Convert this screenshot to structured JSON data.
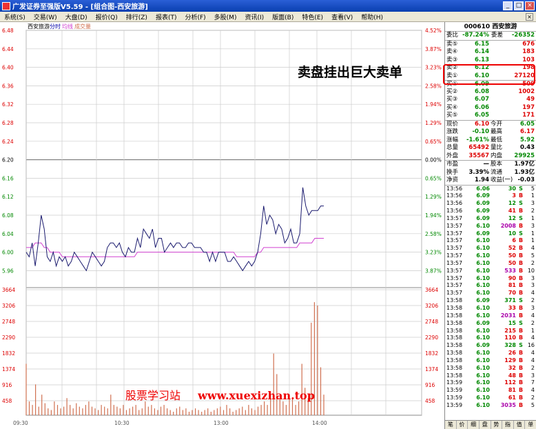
{
  "window": {
    "title": "广发证券至强版V5.59 - [组合图-西安旅游]"
  },
  "window_buttons": {
    "minimize": "_",
    "maximize": "□",
    "close": "×"
  },
  "menu": [
    "系统(S)",
    "交易(W)",
    "大盘(D)",
    "报价(Q)",
    "排行(Z)",
    "报表(T)",
    "分析(F)",
    "多股(M)",
    "资讯(I)",
    "版面(B)",
    "特色(E)",
    "查看(V)",
    "帮助(H)"
  ],
  "menu_close": "×",
  "chart_header": {
    "name": "西安旅游",
    "tab1": "分时",
    "tab2": "均线",
    "tab3": "成交量"
  },
  "colors": {
    "price_line": "#1a1a6e",
    "avg_line": "#d040d0",
    "volume": "#d07050",
    "up": "#dd0000",
    "down": "#008800",
    "grid": "#cccccc"
  },
  "chart_data": {
    "type": "line",
    "price_axis": {
      "ticks": [
        "6.48",
        "6.44",
        "6.40",
        "6.36",
        "6.32",
        "6.28",
        "6.24",
        "6.20",
        "6.16",
        "6.12",
        "6.08",
        "6.04",
        "6.00",
        "5.96"
      ],
      "base": "6.20",
      "ylim": [
        5.94,
        6.48
      ]
    },
    "pct_axis": [
      "4.52%",
      "3.87%",
      "3.23%",
      "2.58%",
      "1.94%",
      "1.29%",
      "0.65%",
      "0.00%",
      "0.65%",
      "1.29%",
      "1.94%",
      "2.58%",
      "3.23%",
      "3.87%"
    ],
    "volume_axis": [
      "3664",
      "3206",
      "2748",
      "2290",
      "1832",
      "1374",
      "916",
      "458"
    ],
    "x_ticks": [
      "09:30",
      "10:30",
      "13:00",
      "14:00"
    ],
    "price": [
      6.0,
      5.99,
      6.02,
      5.97,
      6.02,
      6.08,
      6.05,
      5.99,
      5.98,
      6.0,
      5.97,
      5.99,
      5.98,
      5.99,
      5.97,
      5.98,
      6.0,
      5.99,
      5.98,
      5.97,
      5.96,
      5.98,
      6.0,
      5.99,
      5.98,
      5.97,
      5.98,
      6.01,
      6.02,
      6.02,
      6.01,
      6.02,
      6.0,
      5.99,
      6.01,
      6.0,
      6.0,
      6.03,
      6.01,
      6.05,
      6.04,
      6.03,
      6.05,
      6.01,
      6.03,
      6.03,
      6.0,
      6.01,
      6.02,
      6.01,
      6.02,
      6.02,
      6.01,
      6.01,
      6.02,
      6.02,
      6.01,
      6.01,
      6.01,
      6.0,
      6.0,
      5.98,
      6.0,
      5.98,
      6.0,
      6.0,
      6.0,
      5.98,
      5.98,
      5.99,
      5.98,
      5.97,
      5.96,
      5.97,
      5.98,
      5.97,
      5.98,
      6.0,
      6.04,
      6.1,
      6.06,
      6.08,
      6.07,
      6.04,
      6.06,
      6.05,
      6.02,
      6.03,
      6.05,
      6.02,
      6.02,
      6.04,
      6.14,
      6.1,
      6.08,
      6.09,
      6.09,
      6.09,
      6.1,
      6.1
    ],
    "avg": [
      6.01,
      6.01,
      6.01,
      6.02,
      6.02,
      6.02,
      6.01,
      6.01,
      6.0,
      6.0,
      6.0,
      6.0,
      5.99,
      5.99,
      5.99,
      5.99,
      5.99,
      5.99,
      5.99,
      5.99,
      5.99,
      5.99,
      5.99,
      5.99,
      5.99,
      5.99,
      5.99,
      5.99,
      5.99,
      5.99,
      5.99,
      5.99,
      5.99,
      5.99,
      5.99,
      5.99,
      5.99,
      6.0,
      6.0,
      6.0,
      6.0,
      6.0,
      6.0,
      6.0,
      6.0,
      6.0,
      6.0,
      6.0,
      6.0,
      6.0,
      6.0,
      6.0,
      6.0,
      6.0,
      6.0,
      6.0,
      6.0,
      6.0,
      6.0,
      6.0,
      6.0,
      6.0,
      6.0,
      6.0,
      6.0,
      6.0,
      6.0,
      6.0,
      6.0,
      6.0,
      5.99,
      5.99,
      5.99,
      5.99,
      5.99,
      5.99,
      5.99,
      6.0,
      6.0,
      6.01,
      6.01,
      6.01,
      6.01,
      6.01,
      6.01,
      6.01,
      6.01,
      6.01,
      6.01,
      6.01,
      6.01,
      6.02,
      6.02,
      6.02,
      6.02,
      6.02,
      6.03,
      6.03,
      6.03,
      6.03
    ],
    "volume": [
      1500,
      400,
      300,
      900,
      250,
      600,
      350,
      200,
      150,
      400,
      300,
      200,
      250,
      500,
      300,
      200,
      350,
      250,
      200,
      300,
      400,
      250,
      200,
      150,
      300,
      250,
      200,
      600,
      300,
      250,
      200,
      300,
      150,
      200,
      250,
      300,
      150,
      200,
      400,
      250,
      300,
      200,
      150,
      250,
      300,
      200,
      150,
      100,
      200,
      250,
      150,
      200,
      100,
      150,
      200,
      150,
      100,
      150,
      200,
      100,
      150,
      200,
      250,
      150,
      300,
      200,
      100,
      150,
      200,
      250,
      150,
      300,
      200,
      150,
      250,
      300,
      400,
      300,
      600,
      1800,
      1200,
      500,
      400,
      300,
      600,
      500,
      300,
      400,
      1500,
      800,
      500,
      2700,
      3300,
      3200,
      1400,
      600
    ]
  },
  "quote": {
    "code": "000610",
    "name": "西安旅游",
    "weibi_label": "委比",
    "weibi": "-87.24%",
    "weicha_label": "委差",
    "weicha": "-26352",
    "sell": [
      {
        "label": "卖⑤",
        "price": "6.15",
        "vol": "676"
      },
      {
        "label": "卖④",
        "price": "6.14",
        "vol": "183"
      },
      {
        "label": "卖③",
        "price": "6.13",
        "vol": "103"
      },
      {
        "label": "卖②",
        "price": "6.12",
        "vol": "198"
      },
      {
        "label": "卖①",
        "price": "6.10",
        "vol": "27120"
      }
    ],
    "buy": [
      {
        "label": "买①",
        "price": "6.09",
        "vol": "509"
      },
      {
        "label": "买②",
        "price": "6.08",
        "vol": "1002"
      },
      {
        "label": "买③",
        "price": "6.07",
        "vol": "49"
      },
      {
        "label": "买④",
        "price": "6.06",
        "vol": "197"
      },
      {
        "label": "买⑤",
        "price": "6.05",
        "vol": "171"
      }
    ],
    "info": [
      {
        "l1": "现价",
        "v1": "6.10",
        "l2": "今开",
        "v2": "6.05",
        "c1": "red",
        "c2": "green"
      },
      {
        "l1": "涨跌",
        "v1": "-0.10",
        "l2": "最高",
        "v2": "6.17",
        "c1": "green",
        "c2": "red"
      },
      {
        "l1": "涨幅",
        "v1": "-1.61%",
        "l2": "最低",
        "v2": "5.92",
        "c1": "green",
        "c2": "green"
      },
      {
        "l1": "总量",
        "v1": "65492",
        "l2": "量比",
        "v2": "0.43",
        "c1": "red",
        "c2": "black"
      },
      {
        "l1": "外盘",
        "v1": "35567",
        "l2": "内盘",
        "v2": "29925",
        "c1": "red",
        "c2": "green"
      }
    ],
    "info2": [
      {
        "l1": "市盈",
        "v1": "—",
        "l2": "股本",
        "v2": "1.97亿"
      },
      {
        "l1": "换手",
        "v1": "3.39%",
        "l2": "流通",
        "v2": "1.93亿"
      },
      {
        "l1": "净资",
        "v1": "1.94",
        "l2": "收益(一)",
        "v2": "-0.03"
      }
    ]
  },
  "ticks": [
    {
      "t": "13:56",
      "p": "6.06",
      "v": "30",
      "bs": "S",
      "n": "5"
    },
    {
      "t": "13:56",
      "p": "6.09",
      "v": "3",
      "bs": "B",
      "n": "1"
    },
    {
      "t": "13:56",
      "p": "6.09",
      "v": "12",
      "bs": "S",
      "n": "3"
    },
    {
      "t": "13:56",
      "p": "6.09",
      "v": "41",
      "bs": "B",
      "n": "2"
    },
    {
      "t": "13:57",
      "p": "6.09",
      "v": "12",
      "bs": "S",
      "n": "1"
    },
    {
      "t": "13:57",
      "p": "6.10",
      "v": "2008",
      "bs": "B",
      "n": "3"
    },
    {
      "t": "13:57",
      "p": "6.09",
      "v": "10",
      "bs": "S",
      "n": "1"
    },
    {
      "t": "13:57",
      "p": "6.10",
      "v": "6",
      "bs": "B",
      "n": "1"
    },
    {
      "t": "13:57",
      "p": "6.10",
      "v": "52",
      "bs": "B",
      "n": "4"
    },
    {
      "t": "13:57",
      "p": "6.10",
      "v": "50",
      "bs": "B",
      "n": "5"
    },
    {
      "t": "13:57",
      "p": "6.10",
      "v": "50",
      "bs": "B",
      "n": "2"
    },
    {
      "t": "13:57",
      "p": "6.10",
      "v": "533",
      "bs": "B",
      "n": "10"
    },
    {
      "t": "13:57",
      "p": "6.10",
      "v": "90",
      "bs": "B",
      "n": "3"
    },
    {
      "t": "13:57",
      "p": "6.10",
      "v": "81",
      "bs": "B",
      "n": "3"
    },
    {
      "t": "13:57",
      "p": "6.10",
      "v": "70",
      "bs": "B",
      "n": "4"
    },
    {
      "t": "13:58",
      "p": "6.09",
      "v": "371",
      "bs": "S",
      "n": "2"
    },
    {
      "t": "13:58",
      "p": "6.10",
      "v": "33",
      "bs": "B",
      "n": "3"
    },
    {
      "t": "13:58",
      "p": "6.10",
      "v": "2031",
      "bs": "B",
      "n": "4"
    },
    {
      "t": "13:58",
      "p": "6.09",
      "v": "15",
      "bs": "S",
      "n": "2"
    },
    {
      "t": "13:58",
      "p": "6.10",
      "v": "215",
      "bs": "B",
      "n": "1"
    },
    {
      "t": "13:58",
      "p": "6.10",
      "v": "110",
      "bs": "B",
      "n": "4"
    },
    {
      "t": "13:58",
      "p": "6.09",
      "v": "328",
      "bs": "S",
      "n": "16"
    },
    {
      "t": "13:58",
      "p": "6.10",
      "v": "26",
      "bs": "B",
      "n": "4"
    },
    {
      "t": "13:58",
      "p": "6.10",
      "v": "129",
      "bs": "B",
      "n": "4"
    },
    {
      "t": "13:58",
      "p": "6.10",
      "v": "32",
      "bs": "B",
      "n": "2"
    },
    {
      "t": "13:58",
      "p": "6.10",
      "v": "48",
      "bs": "B",
      "n": "3"
    },
    {
      "t": "13:59",
      "p": "6.10",
      "v": "112",
      "bs": "B",
      "n": "7"
    },
    {
      "t": "13:59",
      "p": "6.10",
      "v": "81",
      "bs": "B",
      "n": "4"
    },
    {
      "t": "13:59",
      "p": "6.10",
      "v": "61",
      "bs": "B",
      "n": "2"
    },
    {
      "t": "13:59",
      "p": "6.10",
      "v": "3035",
      "bs": "B",
      "n": "5"
    }
  ],
  "bottom_tabs": [
    "笔",
    "价",
    "细",
    "盘",
    "势",
    "指",
    "值",
    "单"
  ],
  "annotation": {
    "callout": "卖盘挂出巨大卖单",
    "watermark_cn": "股票学习站",
    "watermark_url": "www.xuexizhan.top"
  }
}
